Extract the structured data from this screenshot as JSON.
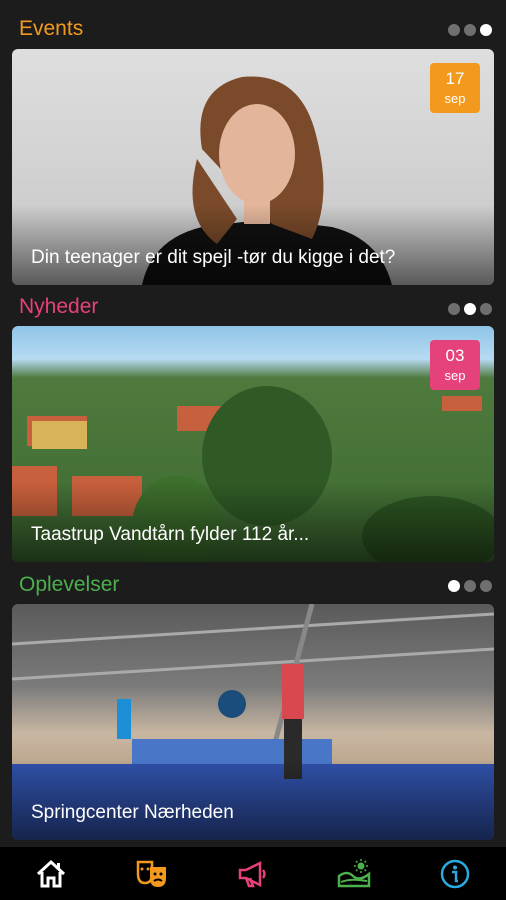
{
  "colors": {
    "events": "#f39a1e",
    "nyheder": "#e5417a",
    "oplevelser": "#4cb04d",
    "info": "#2aa9e0"
  },
  "sections": [
    {
      "title": "Events",
      "dots_active": 2,
      "card": {
        "caption": "Din teenager er dit spejl -tør du kigge i det?",
        "date_day": "17",
        "date_month": "sep"
      }
    },
    {
      "title": "Nyheder",
      "dots_active": 1,
      "card": {
        "caption": "Taastrup Vandtårn fylder 112 år...",
        "date_day": "03",
        "date_month": "sep"
      }
    },
    {
      "title": "Oplevelser",
      "dots_active": 0,
      "card": {
        "caption": "Springcenter Nærheden"
      }
    }
  ],
  "tabbar": {
    "icons": [
      "home-icon",
      "theater-masks-icon",
      "megaphone-icon",
      "landscape-sun-icon",
      "info-icon"
    ]
  }
}
